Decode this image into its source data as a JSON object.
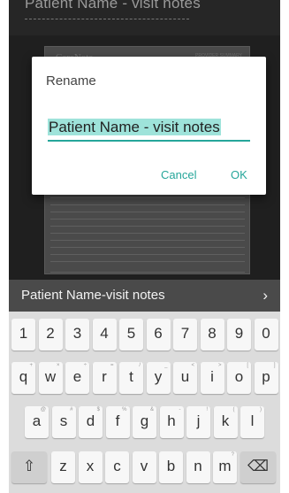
{
  "top_title": "Patient Name - visit notes",
  "document": {
    "logo": "CareNote",
    "header_right": "PROVIDER SUMMARY",
    "caption": "VISIT SUMMARY"
  },
  "dialog": {
    "title": "Rename",
    "input_value": "Patient Name - visit notes",
    "cancel_label": "Cancel",
    "ok_label": "OK"
  },
  "suggestion": {
    "text": "Patient Name-visit notes",
    "arrow": "›"
  },
  "keyboard": {
    "number_row": [
      "1",
      "2",
      "3",
      "4",
      "5",
      "6",
      "7",
      "8",
      "9",
      "0"
    ],
    "row1": [
      "q",
      "w",
      "e",
      "r",
      "t",
      "y",
      "u",
      "i",
      "o",
      "p"
    ],
    "row1_hints": [
      "+",
      "×",
      "÷",
      "=",
      "/",
      "_",
      "<",
      ">",
      "[",
      "]"
    ],
    "row2": [
      "a",
      "s",
      "d",
      "f",
      "g",
      "h",
      "j",
      "k",
      "l"
    ],
    "row2_hints": [
      "@",
      "#",
      "$",
      "%",
      "&",
      "-",
      "!",
      "(",
      ")"
    ],
    "row3": [
      "z",
      "x",
      "c",
      "v",
      "b",
      "n",
      "m"
    ],
    "row3_hints": [
      "",
      "",
      "",
      "",
      "",
      "",
      "?"
    ],
    "shift_label": "⇧",
    "backspace_label": "⌫"
  },
  "colors": {
    "accent": "#26a69a",
    "selection": "#9ee3da",
    "keyboard_bg": "#dcdcdc",
    "suggestion_bg": "#4a4a4a"
  }
}
